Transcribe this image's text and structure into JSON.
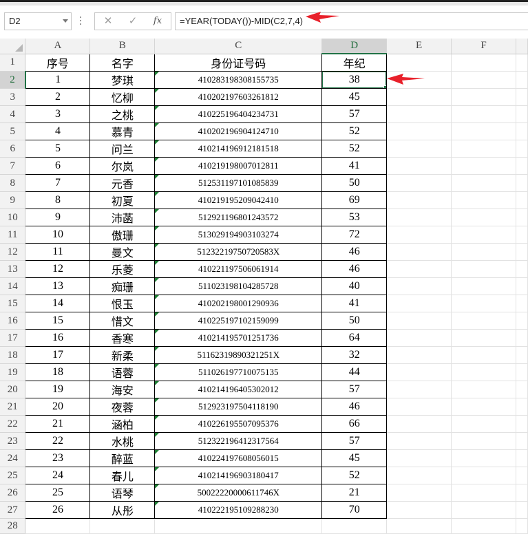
{
  "name_box": "D2",
  "formula_buttons": {
    "cancel": "✕",
    "enter": "✓",
    "fx": "fx"
  },
  "formula": "=YEAR(TODAY())-MID(C2,7,4)",
  "columns": [
    "A",
    "B",
    "C",
    "D",
    "E",
    "F"
  ],
  "header": {
    "A": "序号",
    "B": "名字",
    "C": "身份证号码",
    "D": "年纪"
  },
  "rows": [
    {
      "n": "1",
      "name": "梦琪",
      "id": "410283198308155735",
      "age": "38"
    },
    {
      "n": "2",
      "name": "忆柳",
      "id": "410202197603261812",
      "age": "45"
    },
    {
      "n": "3",
      "name": "之桃",
      "id": "410225196404234731",
      "age": "57"
    },
    {
      "n": "4",
      "name": "慕青",
      "id": "410202196904124710",
      "age": "52"
    },
    {
      "n": "5",
      "name": "问兰",
      "id": "410214196912181518",
      "age": "52"
    },
    {
      "n": "6",
      "name": "尔岚",
      "id": "410219198007012811",
      "age": "41"
    },
    {
      "n": "7",
      "name": "元香",
      "id": "512531197101085839",
      "age": "50"
    },
    {
      "n": "8",
      "name": "初夏",
      "id": "410219195209042410",
      "age": "69"
    },
    {
      "n": "9",
      "name": "沛菡",
      "id": "512921196801243572",
      "age": "53"
    },
    {
      "n": "10",
      "name": "傲珊",
      "id": "513029194903103274",
      "age": "72"
    },
    {
      "n": "11",
      "name": "曼文",
      "id": "51232219750720583X",
      "age": "46"
    },
    {
      "n": "12",
      "name": "乐菱",
      "id": "410221197506061914",
      "age": "46"
    },
    {
      "n": "13",
      "name": "痴珊",
      "id": "511023198104285728",
      "age": "40"
    },
    {
      "n": "14",
      "name": "恨玉",
      "id": "410202198001290936",
      "age": "41"
    },
    {
      "n": "15",
      "name": "惜文",
      "id": "410225197102159099",
      "age": "50"
    },
    {
      "n": "16",
      "name": "香寒",
      "id": "410214195701251736",
      "age": "64"
    },
    {
      "n": "17",
      "name": "新柔",
      "id": "51162319890321251X",
      "age": "32"
    },
    {
      "n": "18",
      "name": "语蓉",
      "id": "511026197710075135",
      "age": "44"
    },
    {
      "n": "19",
      "name": "海安",
      "id": "410214196405302012",
      "age": "57"
    },
    {
      "n": "20",
      "name": "夜蓉",
      "id": "512923197504118190",
      "age": "46"
    },
    {
      "n": "21",
      "name": "涵柏",
      "id": "410226195507095376",
      "age": "66"
    },
    {
      "n": "22",
      "name": "水桃",
      "id": "512322196412317564",
      "age": "57"
    },
    {
      "n": "23",
      "name": "醉蓝",
      "id": "410224197608056015",
      "age": "45"
    },
    {
      "n": "24",
      "name": "春儿",
      "id": "410214196903180417",
      "age": "52"
    },
    {
      "n": "25",
      "name": "语琴",
      "id": "50022220000611746X",
      "age": "21"
    },
    {
      "n": "26",
      "name": "从彤",
      "id": "410222195109288230",
      "age": "70"
    }
  ],
  "colors": {
    "accent": "#217346",
    "arrow": "#e8202a",
    "error_flag": "#1e7e34"
  },
  "icons": {
    "name_box_dropdown": "chevron-down-icon",
    "select_all": "select-all-icon"
  }
}
